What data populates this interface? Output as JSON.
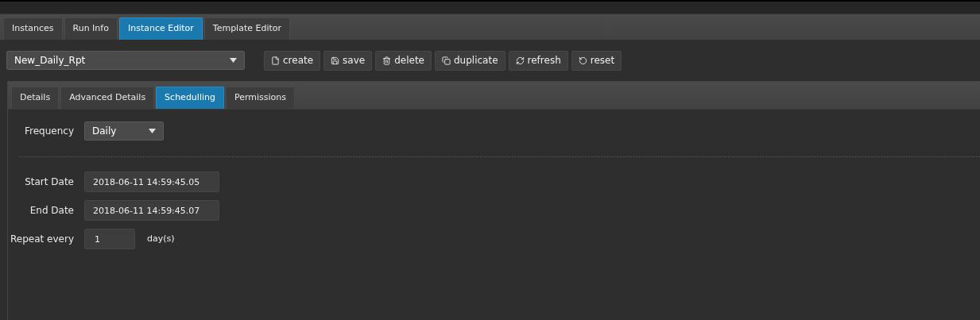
{
  "main_tabs": [
    {
      "label": "Instances",
      "selected": false
    },
    {
      "label": "Run Info",
      "selected": false
    },
    {
      "label": "Instance Editor",
      "selected": true
    },
    {
      "label": "Template Editor",
      "selected": false
    }
  ],
  "instance_select": {
    "value": "New_Daily_Rpt"
  },
  "toolbar": [
    {
      "kind": "create",
      "label": "create"
    },
    {
      "kind": "save",
      "label": "save"
    },
    {
      "kind": "delete",
      "label": "delete"
    },
    {
      "kind": "duplicate",
      "label": "duplicate"
    },
    {
      "kind": "refresh",
      "label": "refresh"
    },
    {
      "kind": "reset",
      "label": "reset"
    }
  ],
  "sub_tabs": [
    {
      "label": "Details",
      "selected": false
    },
    {
      "label": "Advanced Details",
      "selected": false
    },
    {
      "label": "Schedulling",
      "selected": true
    },
    {
      "label": "Permissions",
      "selected": false
    }
  ],
  "frequency": {
    "label": "Frequency",
    "value": "Daily"
  },
  "start_date": {
    "label": "Start Date",
    "value": "2018-06-11 14:59:45.05"
  },
  "end_date": {
    "label": "End Date",
    "value": "2018-06-11 14:59:45.07"
  },
  "repeat": {
    "label": "Repeat every",
    "value": "1",
    "unit": "day(s)"
  }
}
